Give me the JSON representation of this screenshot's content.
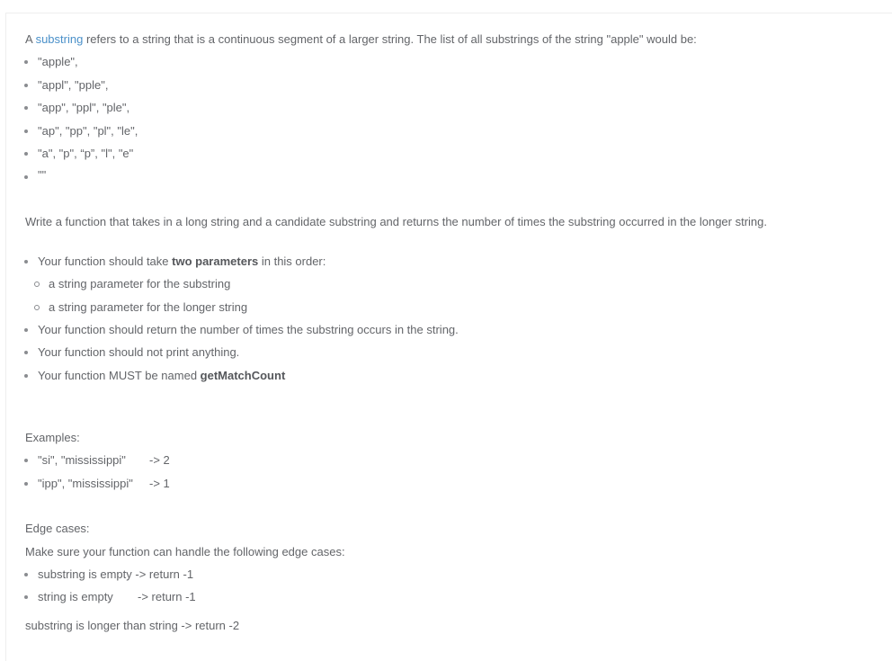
{
  "intro": {
    "prefix": "A ",
    "link": "substring",
    "suffix": " refers to a string that is a continuous segment of a larger string.  The list of all substrings of the string \"apple\" would be:"
  },
  "apple_substrings": [
    "\"apple\",",
    "\"appl\", \"pple\",",
    "\"app\", \"ppl\", \"ple\",",
    "\"ap\", \"pp\", \"pl\", \"le\",",
    "\"a\", \"p\", “p”, \"l\", \"e\"",
    "\"\""
  ],
  "task": "Write a function that takes in a long string and a candidate substring and returns the number of times the substring occurred in the longer string.",
  "requirements": {
    "params_prefix": "Your function should take ",
    "params_bold": "two parameters",
    "params_suffix": " in this order:",
    "params": [
      "a string parameter for the substring",
      "a string parameter for the longer string"
    ],
    "return_rule": "Your function should return the number of times the substring occurs in the string.",
    "print_rule": "Your function should not print anything.",
    "name_prefix": "Your function MUST be named ",
    "name_bold": "getMatchCount"
  },
  "examples": {
    "heading": "Examples:",
    "items": [
      {
        "input": "\"si\", \"mississippi\"",
        "output": "-> 2"
      },
      {
        "input": "\"ipp\", \"mississippi\"",
        "output": "-> 1"
      }
    ]
  },
  "edge_cases": {
    "heading": "Edge cases:",
    "intro": "Make sure your function can handle the following edge cases:",
    "items": [
      {
        "case": "substring is empty",
        "result": "-> return -1"
      },
      {
        "case": "string is empty",
        "result": "-> return -1"
      }
    ],
    "longer": "substring is longer than string -> return -2"
  }
}
